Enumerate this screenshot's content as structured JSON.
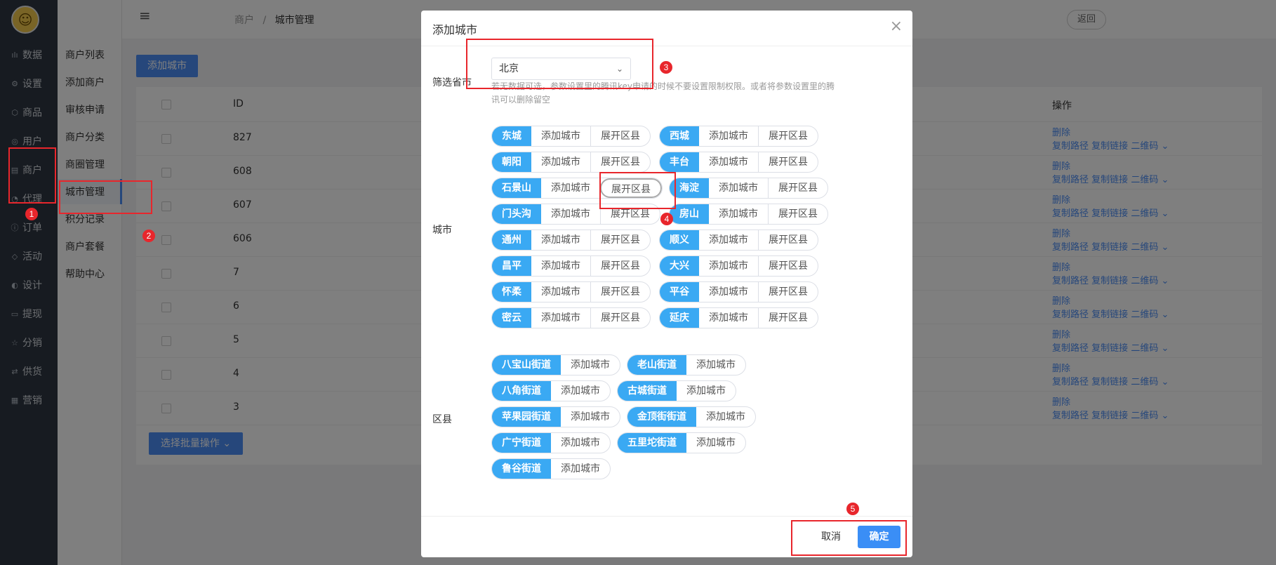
{
  "sidebar": {
    "items": [
      {
        "icon": "chart-icon",
        "glyph": "ılı",
        "label": "数据"
      },
      {
        "icon": "gear-icon",
        "glyph": "⚙",
        "label": "设置"
      },
      {
        "icon": "cube-icon",
        "glyph": "⬡",
        "label": "商品"
      },
      {
        "icon": "user-icon",
        "glyph": "◎",
        "label": "用户"
      },
      {
        "icon": "store-icon",
        "glyph": "▤",
        "label": "商户"
      },
      {
        "icon": "agent-icon",
        "glyph": "◔",
        "label": "代理"
      },
      {
        "icon": "order-icon",
        "glyph": "ⓘ",
        "label": "订单"
      },
      {
        "icon": "tag-icon",
        "glyph": "◇",
        "label": "活动"
      },
      {
        "icon": "palette-icon",
        "glyph": "◐",
        "label": "设计"
      },
      {
        "icon": "card-icon",
        "glyph": "▭",
        "label": "提现"
      },
      {
        "icon": "star-icon",
        "glyph": "☆",
        "label": "分销"
      },
      {
        "icon": "swap-icon",
        "glyph": "⇄",
        "label": "供货"
      },
      {
        "icon": "grid-icon",
        "glyph": "▦",
        "label": "营销"
      }
    ]
  },
  "subnav": {
    "items": [
      "商户列表",
      "添加商户",
      "审核申请",
      "商户分类",
      "商圈管理",
      "城市管理",
      "积分记录",
      "商户套餐",
      "帮助中心"
    ]
  },
  "topbar": {
    "crumb_parent": "商户",
    "crumb_sep": "/",
    "crumb_current": "城市管理",
    "back": "返回"
  },
  "main": {
    "add_button": "添加城市",
    "col_id": "ID",
    "col_op": "操作",
    "batch_button": "选择批量操作 ⌄",
    "rows": [
      {
        "id": "827"
      },
      {
        "id": "608"
      },
      {
        "id": "607"
      },
      {
        "id": "606"
      },
      {
        "id": "7"
      },
      {
        "id": "6"
      },
      {
        "id": "5"
      },
      {
        "id": "4"
      },
      {
        "id": "3"
      }
    ],
    "op_delete": "删除",
    "op_copy_path": "复制路径",
    "op_copy_link": "复制链接",
    "op_qrcode": "二维码 ⌄"
  },
  "modal": {
    "title": "添加城市",
    "close": "×",
    "province_label": "筛选省市",
    "province_value": "北京",
    "hint": "若无数据可选，参数设置里的腾讯key申请的时候不要设置限制权限。或者将参数设置里的腾讯可以删除留空",
    "city_label": "城市",
    "district_label": "区县",
    "add_city": "添加城市",
    "expand": "展开区县",
    "cities": [
      "东城",
      "西城",
      "朝阳",
      "丰台",
      "石景山",
      "海淀",
      "门头沟",
      "房山",
      "通州",
      "顺义",
      "昌平",
      "大兴",
      "怀柔",
      "平谷",
      "密云",
      "延庆"
    ],
    "districts": [
      "八宝山街道",
      "老山街道",
      "八角街道",
      "古城街道",
      "苹果园街道",
      "金顶街街道",
      "广宁街道",
      "五里坨街道",
      "鲁谷街道"
    ],
    "cancel": "取消",
    "ok": "确定"
  },
  "badges": [
    "1",
    "2",
    "3",
    "4",
    "5"
  ],
  "colors": {
    "accent": "#4c8ef7",
    "tag": "#3aa9f3",
    "annotation": "#e8262c",
    "sidebar": "#2e3743"
  }
}
